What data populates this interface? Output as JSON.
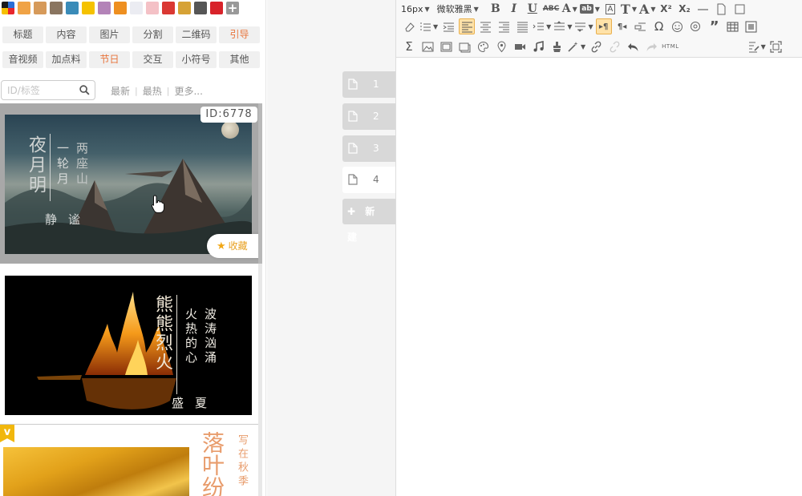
{
  "colors": {
    "swatches": [
      "multicolor",
      "#f0a346",
      "#d69a5a",
      "#8a7560",
      "#3a8bb8",
      "#f5c200",
      "#b383b8",
      "#ee8f20",
      "#ebecf2",
      "#f4c1c6",
      "#da3833",
      "#d6a236",
      "#565656",
      "#d8232a",
      "add"
    ]
  },
  "categories": [
    {
      "label": "标题",
      "accent": false
    },
    {
      "label": "内容",
      "accent": false
    },
    {
      "label": "图片",
      "accent": false
    },
    {
      "label": "分割",
      "accent": false
    },
    {
      "label": "二维码",
      "accent": false
    },
    {
      "label": "引导",
      "accent": true
    },
    {
      "label": "音视频",
      "accent": false
    },
    {
      "label": "加点料",
      "accent": false
    },
    {
      "label": "节日",
      "accent": true
    },
    {
      "label": "交互",
      "accent": false
    },
    {
      "label": "小符号",
      "accent": false
    },
    {
      "label": "其他",
      "accent": false
    }
  ],
  "search": {
    "placeholder": "ID/标签"
  },
  "filters": {
    "newest": "最新",
    "hottest": "最热",
    "more": "更多..."
  },
  "cards": {
    "card1": {
      "id_badge": "ID:6778",
      "title": "夜月明",
      "sub1": "一轮月",
      "sub2": "两座山",
      "bottom": "静谧",
      "fav": "收藏"
    },
    "card2": {
      "title": "熊熊烈火",
      "sub1": "火热的心",
      "sub2": "波涛汹涌",
      "bottom": "盛夏"
    },
    "card3": {
      "badge": "v",
      "title": "落叶纷",
      "sub": "写在秋季"
    }
  },
  "pages": {
    "tabs": [
      "1",
      "2",
      "3",
      "4"
    ],
    "active": "4",
    "new_label": "✚ 新 建"
  },
  "toolbar": {
    "font_size": "16px",
    "font_family": "微软雅黑",
    "html_label": "HTML"
  }
}
